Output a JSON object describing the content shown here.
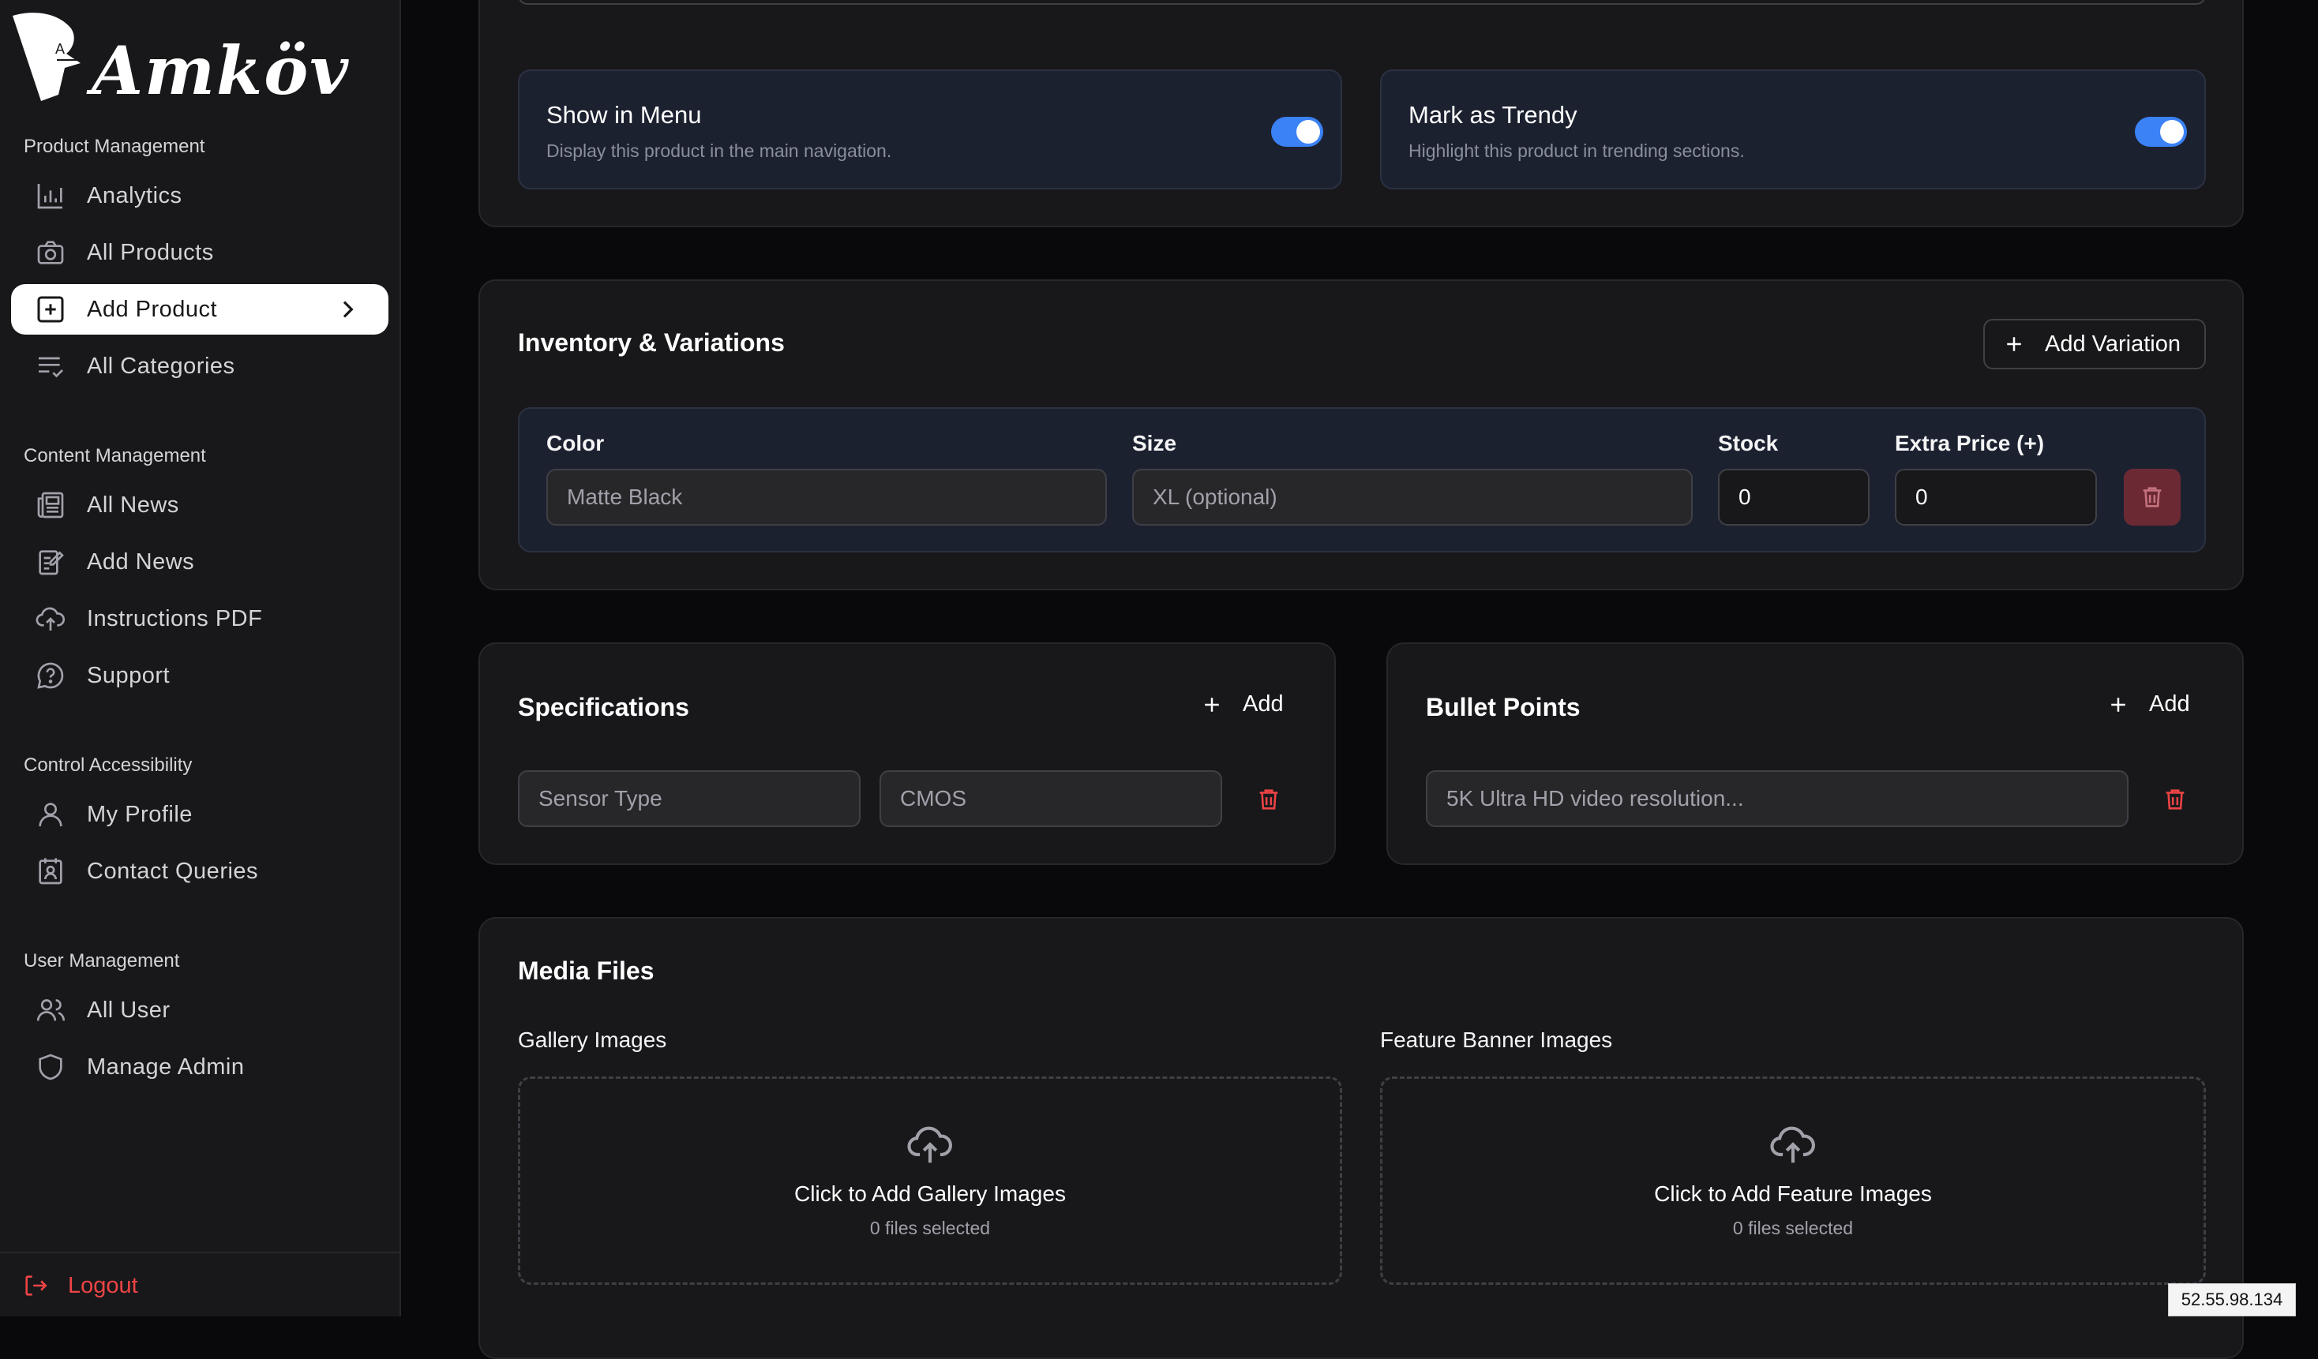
{
  "brand": {
    "logo_text": "Amköv"
  },
  "sidebar": {
    "groups": [
      {
        "title": "Product Management",
        "items": [
          {
            "label": "Analytics",
            "icon": "bar-chart-icon"
          },
          {
            "label": "All Products",
            "icon": "camera-icon"
          },
          {
            "label": "Add Product",
            "icon": "plus-square-icon",
            "active": true
          },
          {
            "label": "All Categories",
            "icon": "list-check-icon"
          }
        ]
      },
      {
        "title": "Content Management",
        "items": [
          {
            "label": "All News",
            "icon": "newspaper-icon"
          },
          {
            "label": "Add News",
            "icon": "edit-note-icon"
          },
          {
            "label": "Instructions PDF",
            "icon": "cloud-upload-icon"
          },
          {
            "label": "Support",
            "icon": "help-circle-icon"
          }
        ]
      },
      {
        "title": "Control Accessibility",
        "items": [
          {
            "label": "My Profile",
            "icon": "user-icon"
          },
          {
            "label": "Contact Queries",
            "icon": "contact-card-icon"
          }
        ]
      },
      {
        "title": "User Management",
        "items": [
          {
            "label": "All User",
            "icon": "users-icon"
          },
          {
            "label": "Manage Admin",
            "icon": "shield-icon"
          }
        ]
      }
    ],
    "logout_label": "Logout"
  },
  "visibility": {
    "show_in_menu": {
      "title": "Show in Menu",
      "description": "Display this product in the main navigation.",
      "enabled": true
    },
    "mark_trendy": {
      "title": "Mark as Trendy",
      "description": "Highlight this product in trending sections.",
      "enabled": true
    }
  },
  "inventory": {
    "title": "Inventory & Variations",
    "add_label": "Add Variation",
    "columns": {
      "color": "Color",
      "size": "Size",
      "stock": "Stock",
      "extra_price": "Extra Price (+)"
    },
    "row": {
      "color": "Matte Black",
      "size": "XL (optional)",
      "stock": "0",
      "extra_price": "0"
    }
  },
  "specifications": {
    "title": "Specifications",
    "add_label": "Add",
    "row": {
      "key": "Sensor Type",
      "value": "CMOS"
    }
  },
  "bullets": {
    "title": "Bullet Points",
    "add_label": "Add",
    "row": {
      "text": "5K Ultra HD video resolution..."
    }
  },
  "media": {
    "title": "Media Files",
    "gallery": {
      "label": "Gallery Images",
      "cta": "Click to Add Gallery Images",
      "count": "0 files selected"
    },
    "feature": {
      "label": "Feature Banner Images",
      "cta": "Click to Add Feature Images",
      "count": "0 files selected"
    }
  },
  "ip_badge": "52.55.98.134",
  "colors": {
    "accent": "#3b82f6",
    "danger": "#ef4444",
    "card": "#18181b",
    "inner": "#1c2130",
    "bg": "#09090b"
  }
}
